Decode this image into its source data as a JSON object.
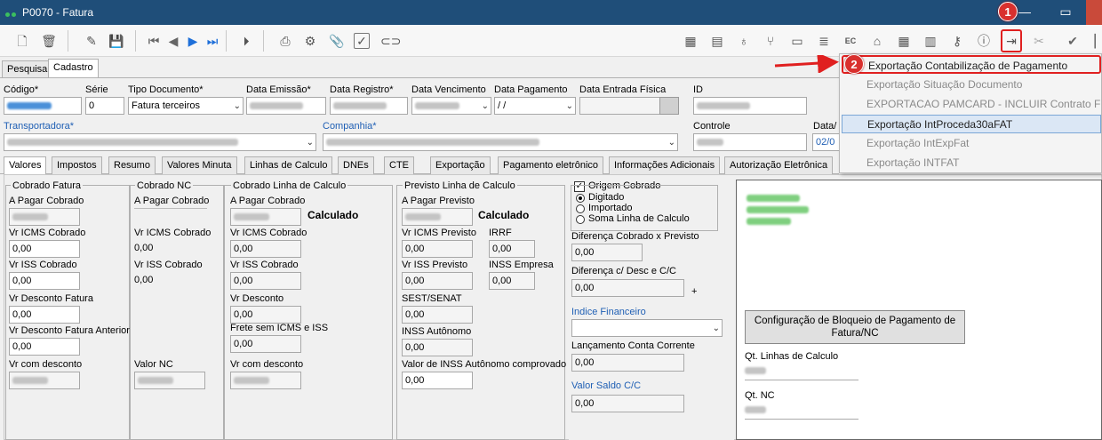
{
  "window": {
    "title": "P0070 - Fatura",
    "minimize": "—",
    "maximize": "▭"
  },
  "annotations": {
    "badge1": "1",
    "badge2": "2"
  },
  "main_tabs": [
    "Pesquisa",
    "Cadastro"
  ],
  "header": {
    "codigo_label": "Código*",
    "serie_label": "Série",
    "serie_value": "0",
    "tipo_doc_label": "Tipo Documento*",
    "tipo_doc_value": "Fatura terceiros",
    "data_emissao_label": "Data Emissão*",
    "data_registro_label": "Data Registro*",
    "data_vencimento_label": "Data Vencimento",
    "data_pagamento_label": "Data Pagamento",
    "data_pagamento_value": " / /",
    "data_entrada_label": "Data Entrada Física",
    "id_label": "ID",
    "transportadora_label": "Transportadora*",
    "companhia_label": "Companhia*",
    "controle_label": "Controle",
    "data_partial_label": "Data/",
    "data_partial_value": "02/0"
  },
  "sub_tabs": [
    "Valores",
    "Impostos",
    "Resumo",
    "Valores Minuta",
    "Linhas de Calculo",
    "DNEs",
    "CTE",
    "Exportação",
    "Pagamento eletrônico",
    "Informações Adicionais",
    "Autorização Eletrônica"
  ],
  "menu": {
    "items": [
      "Exportação Contabilização de Pagamento",
      "Exportação Situação Documento",
      "EXPORTACAO PAMCARD - INCLUIR Contrato FRETE",
      "Exportação IntProceda30aFAT",
      "Exportação IntExpFat",
      "Exportação INTFAT"
    ]
  },
  "cobrado_fatura": {
    "title": "Cobrado Fatura",
    "a_pagar": "A Pagar Cobrado",
    "icms": "Vr ICMS Cobrado",
    "icms_value": "0,00",
    "iss": "Vr ISS Cobrado",
    "iss_value": "0,00",
    "desconto": "Vr Desconto Fatura",
    "desconto_value": "0,00",
    "desconto_ant": "Vr Desconto Fatura Anterior",
    "desconto_ant_value": "0,00",
    "com_desconto": "Vr com desconto"
  },
  "cobrado_nc": {
    "title": "Cobrado NC",
    "a_pagar": "A Pagar Cobrado",
    "icms": "Vr ICMS Cobrado",
    "icms_value": "0,00",
    "iss": "Vr ISS Cobrado",
    "iss_value": "0,00",
    "valor_nc": "Valor NC"
  },
  "cobrado_linha": {
    "title": "Cobrado Linha de Calculo",
    "a_pagar": "A Pagar Cobrado",
    "calculado": "Calculado",
    "icms": "Vr ICMS Cobrado",
    "icms_value": "0,00",
    "iss": "Vr ISS Cobrado",
    "iss_value": "0,00",
    "desconto": "Vr Desconto",
    "desconto_value": "0,00",
    "frete": "Frete sem ICMS e ISS",
    "frete_value": "0,00",
    "com_desconto": "Vr com desconto"
  },
  "previsto_linha": {
    "title": "Previsto Linha de Calculo",
    "a_pagar": "A Pagar Previsto",
    "calculado": "Calculado",
    "icms": "Vr ICMS Previsto",
    "icms_value": "0,00",
    "irrf": "IRRF",
    "irrf_value": "0,00",
    "iss": "Vr ISS Previsto",
    "iss_value": "0,00",
    "inss_empresa": "INSS Empresa",
    "inss_empresa_value": "0,00",
    "sest": "SEST/SENAT",
    "sest_value": "0,00",
    "inss_autonomo": "INSS Autônomo",
    "inss_autonomo_value": "0,00",
    "inss_comprovado": "Valor de INSS Autônomo comprovado",
    "inss_comprovado_value": "0,00"
  },
  "origem": {
    "checkbox": "Origem Cobrado",
    "radio": [
      "Digitado",
      "Importado",
      "Soma Linha de Calculo"
    ],
    "diff_previsto": "Diferença Cobrado x Previsto",
    "diff_previsto_value": "0,00",
    "diff_desc": "Diferença  c/ Desc e C/C",
    "diff_desc_value": "0,00",
    "plus": "+",
    "indice": "Indice Financeiro",
    "lancamento": "Lançamento Conta Corrente",
    "lancamento_value": "0,00",
    "saldo": "Valor Saldo C/C",
    "saldo_value": "0,00"
  },
  "right_panel": {
    "config_button": "Configuração de Bloqueio de Pagamento de Fatura/NC",
    "qt_linhas": "Qt. Linhas de Calculo",
    "qt_nc": "Qt. NC"
  }
}
